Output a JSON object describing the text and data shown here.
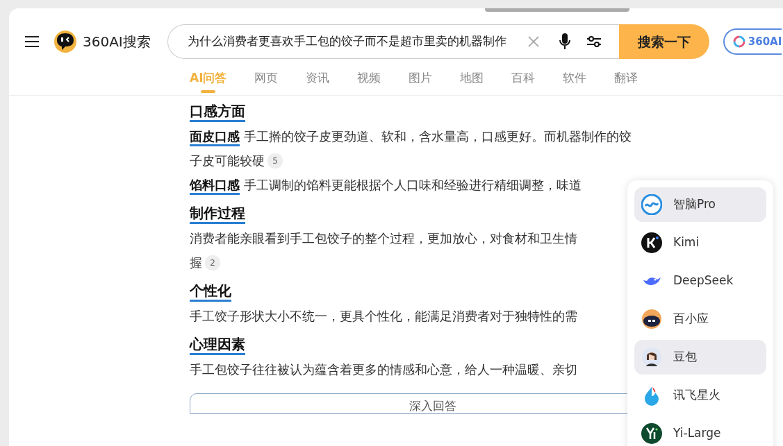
{
  "header": {
    "logo_text": "360AI搜索",
    "query": "为什么消费者更喜欢手工包的饺子而不是超市里卖的机器制作",
    "search_button": "搜索一下",
    "ai_pill": "360AI"
  },
  "tabs": [
    {
      "label": "AI问答",
      "selected": true
    },
    {
      "label": "网页",
      "selected": false
    },
    {
      "label": "资讯",
      "selected": false
    },
    {
      "label": "视频",
      "selected": false
    },
    {
      "label": "图片",
      "selected": false
    },
    {
      "label": "地图",
      "selected": false
    },
    {
      "label": "百科",
      "selected": false
    },
    {
      "label": "软件",
      "selected": false
    },
    {
      "label": "翻译",
      "selected": false
    }
  ],
  "sections": [
    {
      "heading": "口感方面",
      "paragraphs": [
        {
          "term": "面皮口感",
          "lines": [
            "手工擀的饺子皮更劲道、软和，含水量高，口感更好。而机器制作的饺",
            "子皮可能较硬"
          ],
          "cite": "5"
        },
        {
          "term": "馅料口感",
          "lines": [
            "手工调制的馅料更能根据个人口味和经验进行精细调整，味道"
          ]
        }
      ]
    },
    {
      "heading": "制作过程",
      "paragraphs": [
        {
          "lines": [
            "消费者能亲眼看到手工包饺子的整个过程，更加放心，对食材和卫生情",
            "握"
          ],
          "cite": "2"
        }
      ]
    },
    {
      "heading": "个性化",
      "paragraphs": [
        {
          "lines": [
            "手工饺子形状大小不统一，更具个性化，能满足消费者对于独特性的需"
          ]
        }
      ]
    },
    {
      "heading": "心理因素",
      "paragraphs": [
        {
          "lines": [
            "手工包饺子往往被认为蕴含着更多的情感和心意，给人一种温暖、亲切"
          ]
        }
      ]
    }
  ],
  "deep_button": "深入回答",
  "models": [
    {
      "name": "智脑Pro",
      "kind": "wave",
      "highlighted": true
    },
    {
      "name": "Kimi",
      "kind": "k",
      "highlighted": false
    },
    {
      "name": "DeepSeek",
      "kind": "whale",
      "highlighted": false
    },
    {
      "name": "百小应",
      "kind": "bot",
      "highlighted": false
    },
    {
      "name": "豆包",
      "kind": "avatar",
      "highlighted": true
    },
    {
      "name": "讯飞星火",
      "kind": "flame",
      "highlighted": false
    },
    {
      "name": "Yi-Large",
      "kind": "yi",
      "highlighted": false
    }
  ]
}
